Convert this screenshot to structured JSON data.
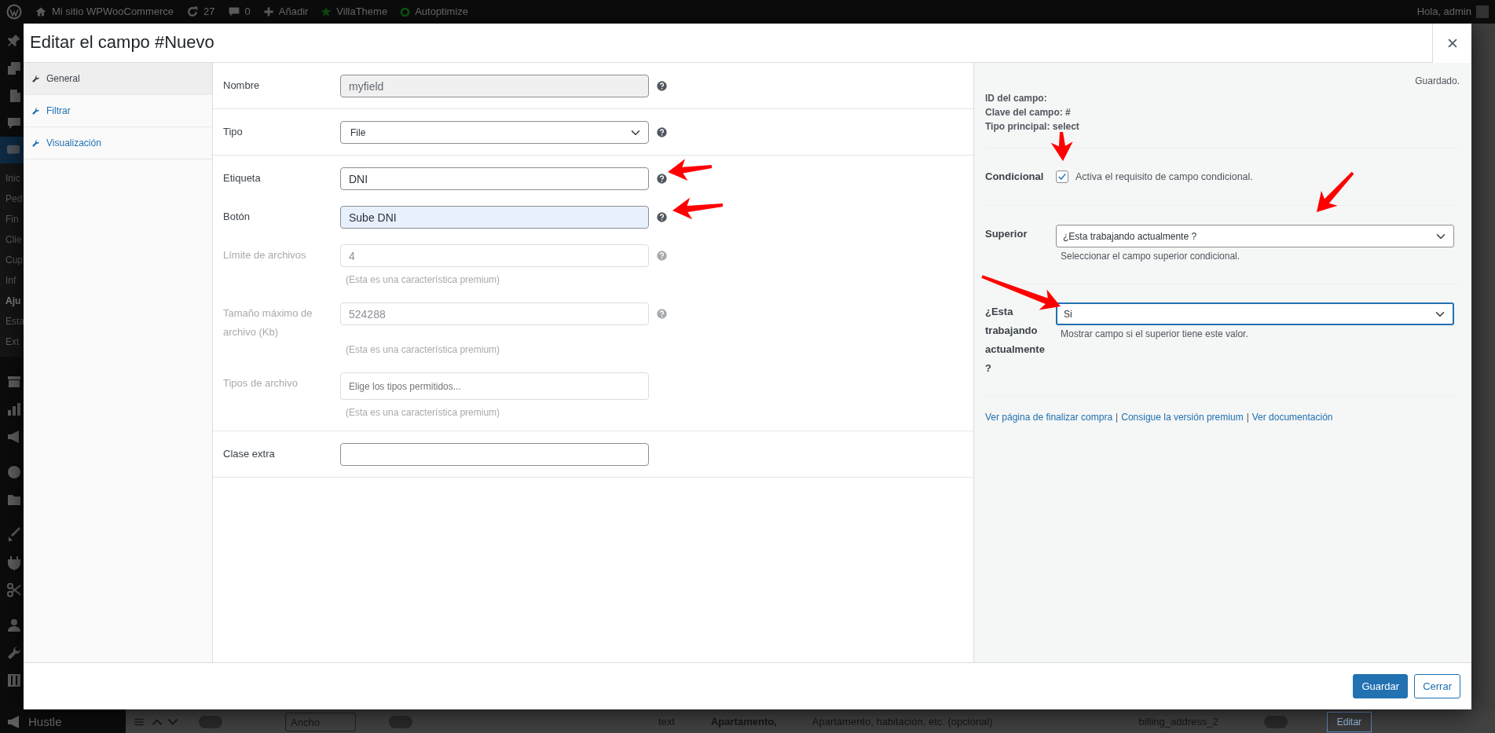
{
  "admin_bar": {
    "site": "Mi sitio WPWooCommerce",
    "updates": "27",
    "comments": "0",
    "new": "Añadir",
    "plugins": [
      {
        "label": "VillaTheme",
        "kind": "star"
      },
      {
        "label": "Autoptimize",
        "kind": "ring"
      }
    ],
    "greeting": "Hola, admin"
  },
  "admin_menu": {
    "submenu": [
      {
        "label": "Inic",
        "current": false
      },
      {
        "label": "Ped",
        "current": false
      },
      {
        "label": "Fin",
        "current": false
      },
      {
        "label": "Clie",
        "current": false
      },
      {
        "label": "Cup",
        "current": false
      },
      {
        "label": "Inf",
        "current": false
      },
      {
        "label": "Aju",
        "current": true
      },
      {
        "label": "Esta",
        "current": false
      },
      {
        "label": "Ext",
        "current": false
      }
    ],
    "bottom_item": "Hustle"
  },
  "background_row": {
    "width_select": "Ancho",
    "type": "text",
    "label": "Apartamento,",
    "placeholder_text": "Apartamento, habitación, etc. (opcional)",
    "name": "billing_address_2",
    "button": "Editar",
    "toggles": [
      {
        "on": false
      },
      {
        "on": false
      },
      {
        "on": false
      }
    ]
  },
  "dialog": {
    "title": "Editar el campo #Nuevo",
    "tabs": [
      {
        "label": "General",
        "selected": true
      },
      {
        "label": "Filtrar",
        "selected": false
      },
      {
        "label": "Visualización",
        "selected": false
      }
    ],
    "groups": [
      {
        "fields": [
          {
            "label": "Nombre",
            "kind": "text",
            "value": "myfield",
            "readonly": true,
            "help": true
          }
        ]
      },
      {
        "fields": [
          {
            "label": "Tipo",
            "kind": "select",
            "value": "File",
            "help": true
          }
        ]
      },
      {
        "fields": [
          {
            "label": "Etiqueta",
            "kind": "text",
            "value": "DNI",
            "help": true
          },
          {
            "label": "Botón",
            "kind": "text",
            "value": "Sube DNI",
            "autofilled": true,
            "help": true
          },
          {
            "label": "Límite de archivos",
            "kind": "text",
            "value": "4",
            "disabled": true,
            "help": true,
            "note": "(Esta es una característica premium)"
          },
          {
            "label": "Tamaño máximo de archivo (Kb)",
            "kind": "text",
            "value": "524288",
            "disabled": true,
            "help": true,
            "note": "(Esta es una característica premium)"
          },
          {
            "label": "Tipos de archivo",
            "kind": "multiselect",
            "placeholder": "Elige los tipos permitidos...",
            "disabled": true,
            "help": false,
            "note": "(Esta es una característica premium)"
          }
        ]
      },
      {
        "fields": [
          {
            "label": "Clase extra",
            "kind": "text",
            "help": false
          }
        ]
      }
    ],
    "side": {
      "status": "Guardado.",
      "info": [
        "ID del campo:",
        "Clave del campo: #",
        "Tipo principal: select"
      ],
      "conditional": {
        "label": "Condicional",
        "checked": true,
        "text": "Activa el requisito de campo condicional."
      },
      "selects": [
        {
          "label": "Superior",
          "value": "¿Esta trabajando actualmente ?",
          "hint": "Seleccionar el campo superior condicional.",
          "focused": false
        },
        {
          "label": "¿Esta trabajando actualmente ?",
          "value": "Si",
          "hint": "Mostrar campo si el superior tiene este valor.",
          "focused": true
        }
      ],
      "links": [
        "Ver página de finalizar compra",
        "Consigue la versión premium",
        "Ver documentación"
      ],
      "separator": "|"
    },
    "buttons": [
      {
        "label": "Guardar",
        "kind": "primary"
      },
      {
        "label": "Cerrar",
        "kind": "secondary"
      }
    ]
  }
}
